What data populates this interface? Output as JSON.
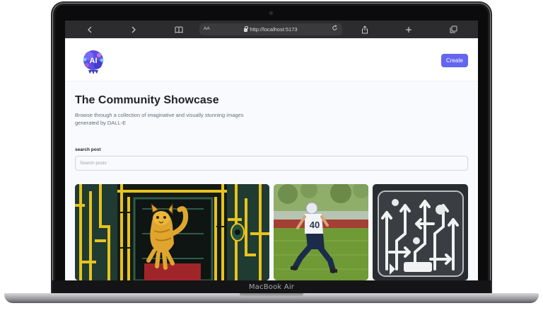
{
  "device": {
    "label": "MacBook Air"
  },
  "browser": {
    "reader_label": "AA",
    "url": "http://localhost:5173",
    "icons": [
      "back-icon",
      "forward-icon",
      "bookmarks-icon",
      "reload-icon",
      "share-icon",
      "new-tab-icon",
      "tabs-icon"
    ]
  },
  "header": {
    "logo_text": "AI",
    "create_label": "Create"
  },
  "hero": {
    "title": "The Community Showcase",
    "subtitle": "Browse through a collection of imaginative and visually stunning images generated by DALL-E"
  },
  "search": {
    "label": "search post",
    "placeholder": "Search posts",
    "value": ""
  },
  "gallery": {
    "cards": [
      {
        "subject": "cat-doorway-image"
      },
      {
        "subject": "football-player-image"
      },
      {
        "subject": "arrows-maze-image"
      }
    ]
  },
  "colors": {
    "accent": "#6366f1",
    "page_bg": "#f9fafe",
    "toolbar": "#2c2c2e",
    "title": "#222328",
    "subtitle": "#666e75"
  }
}
